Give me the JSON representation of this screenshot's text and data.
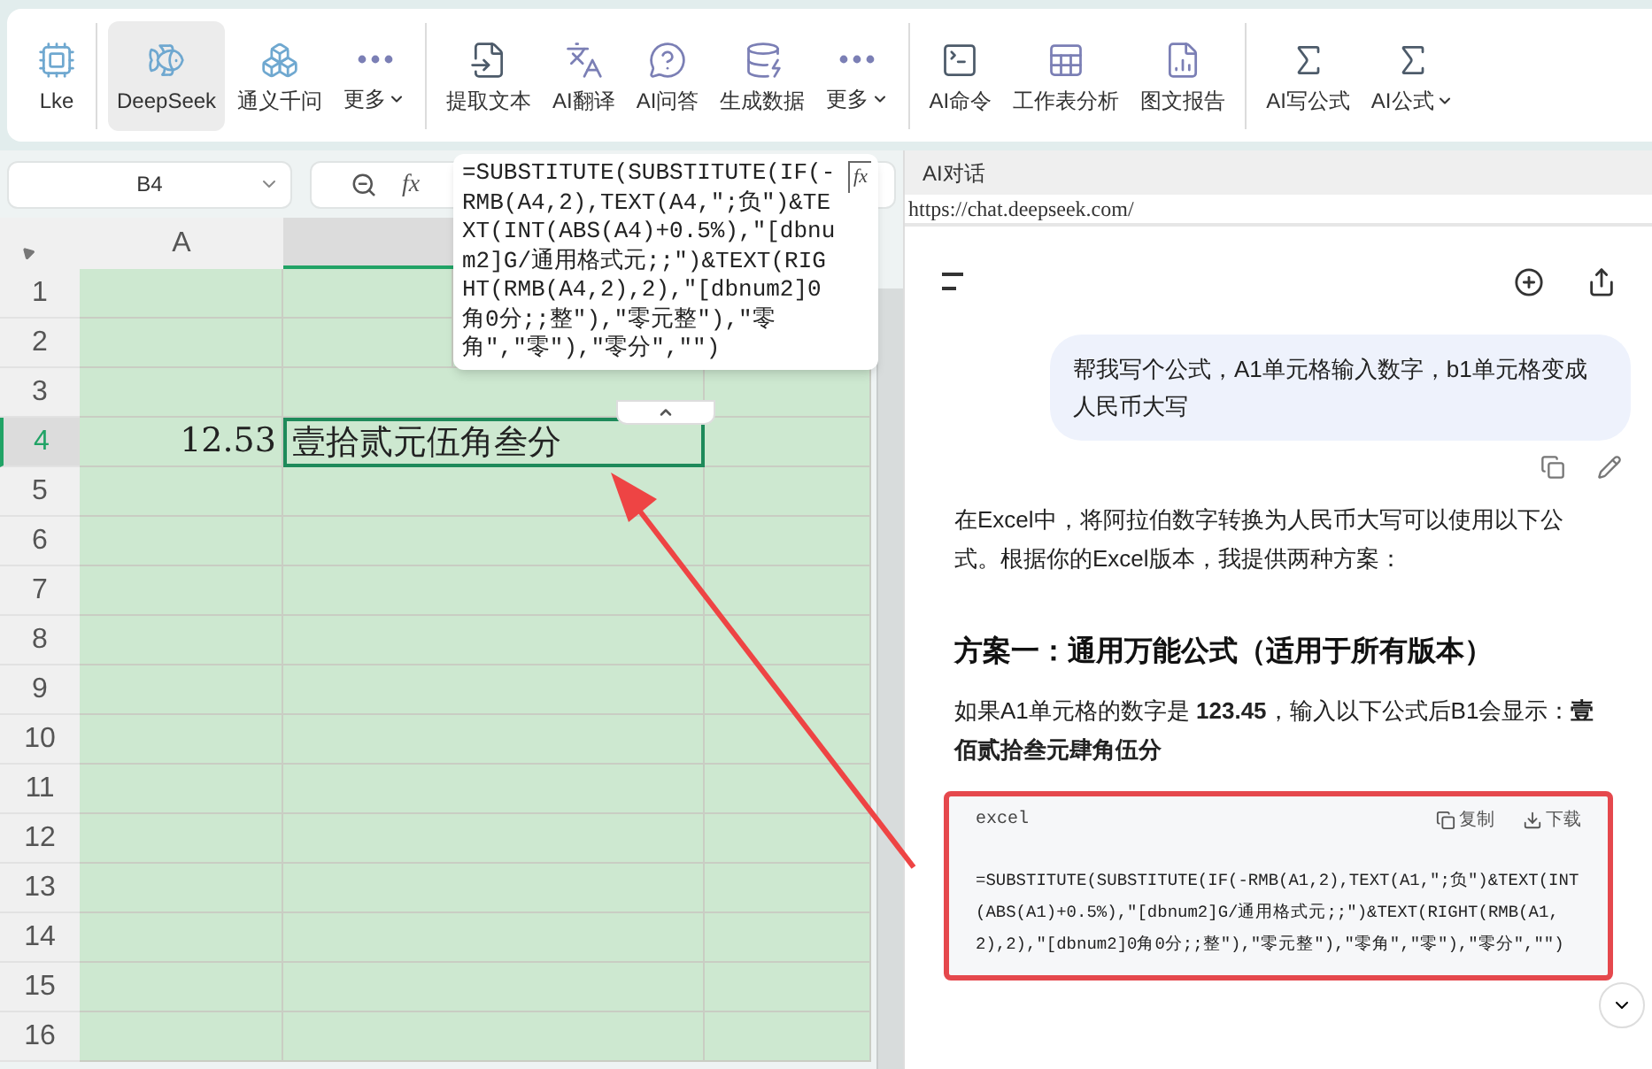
{
  "toolbar": {
    "groups": [
      {
        "items": [
          {
            "label": "Lke",
            "selected": false,
            "dropdown": false
          }
        ]
      },
      {
        "items": [
          {
            "label": "DeepSeek",
            "selected": true,
            "dropdown": false
          },
          {
            "label": "通义千问",
            "selected": false,
            "dropdown": false
          },
          {
            "label": "更多",
            "selected": false,
            "dropdown": true
          }
        ]
      },
      {
        "items": [
          {
            "label": "提取文本",
            "selected": false,
            "dropdown": false
          },
          {
            "label": "AI翻译",
            "selected": false,
            "dropdown": false
          },
          {
            "label": "AI问答",
            "selected": false,
            "dropdown": false
          },
          {
            "label": "生成数据",
            "selected": false,
            "dropdown": false
          },
          {
            "label": "更多",
            "selected": false,
            "dropdown": true
          }
        ]
      },
      {
        "items": [
          {
            "label": "AI命令",
            "selected": false,
            "dropdown": false
          },
          {
            "label": "工作表分析",
            "selected": false,
            "dropdown": false
          },
          {
            "label": "图文报告",
            "selected": false,
            "dropdown": false
          }
        ]
      },
      {
        "items": [
          {
            "label": "AI写公式",
            "selected": false,
            "dropdown": false
          },
          {
            "label": "AI公式",
            "selected": false,
            "dropdown": true
          }
        ]
      }
    ]
  },
  "spreadsheet": {
    "name_box": "B4",
    "function_button": "fx",
    "expand_button": "fx",
    "formula": "=SUBSTITUTE(SUBSTITUTE(IF(-RMB(A4,2),TEXT(A4,\";负\")&TEXT(INT(ABS(A4)+0.5%),\"[dbnum2]G/通用格式元;;\")&TEXT(RIGHT(RMB(A4,2),2),\"[dbnum2]0角0分;;整\"),\"零元整\"),\"零角\",\"零\"),\"零分\",\"\")",
    "columns": [
      {
        "label": "A",
        "selected": false
      },
      {
        "selected": true
      }
    ],
    "rows": [
      {
        "label": "1",
        "selected": false
      },
      {
        "label": "2",
        "selected": false
      },
      {
        "label": "3",
        "selected": false
      },
      {
        "label": "4",
        "selected": true,
        "cells": [
          "12.53",
          "壹拾贰元伍角叁分"
        ]
      },
      {
        "label": "5",
        "selected": false
      },
      {
        "label": "6",
        "selected": false
      },
      {
        "label": "7",
        "selected": false
      },
      {
        "label": "8",
        "selected": false
      },
      {
        "label": "9",
        "selected": false
      },
      {
        "label": "10",
        "selected": false
      },
      {
        "label": "11",
        "selected": false
      },
      {
        "label": "12",
        "selected": false
      },
      {
        "label": "13",
        "selected": false
      },
      {
        "label": "14",
        "selected": false
      },
      {
        "label": "15",
        "selected": false
      },
      {
        "label": "16",
        "selected": false
      }
    ]
  },
  "chat_panel": {
    "title": "AI对话",
    "url": "https://chat.deepseek.com/",
    "user_message": "帮我写个公式，A1单元格输入数字，b1单元格变成人民币大写",
    "answer": {
      "intro": "在Excel中，将阿拉伯数字转换为人民币大写可以使用以下公式。根据你的Excel版本，我提供两种方案：",
      "heading": "方案一：通用万能公式（适用于所有版本）",
      "example": "如果A1单元格的数字是 **123.45**，输入以下公式后B1会显示：**壹佰贰拾叁元肆角伍分**",
      "code_block": {
        "language": "excel",
        "copy": "复制",
        "download": "下载",
        "code": "=SUBSTITUTE(SUBSTITUTE(IF(-RMB(A1,2),TEXT(A1,\";负\")&TEXT(INT(ABS(A1)+0.5%),\"[dbnum2]G/通用格式元;;\")&TEXT(RIGHT(RMB(A1,2),2),\"[dbnum2]0角0分;;整\"),\"零元整\"),\"零角\",\"零\"),\"零分\",\"\")"
      }
    }
  }
}
